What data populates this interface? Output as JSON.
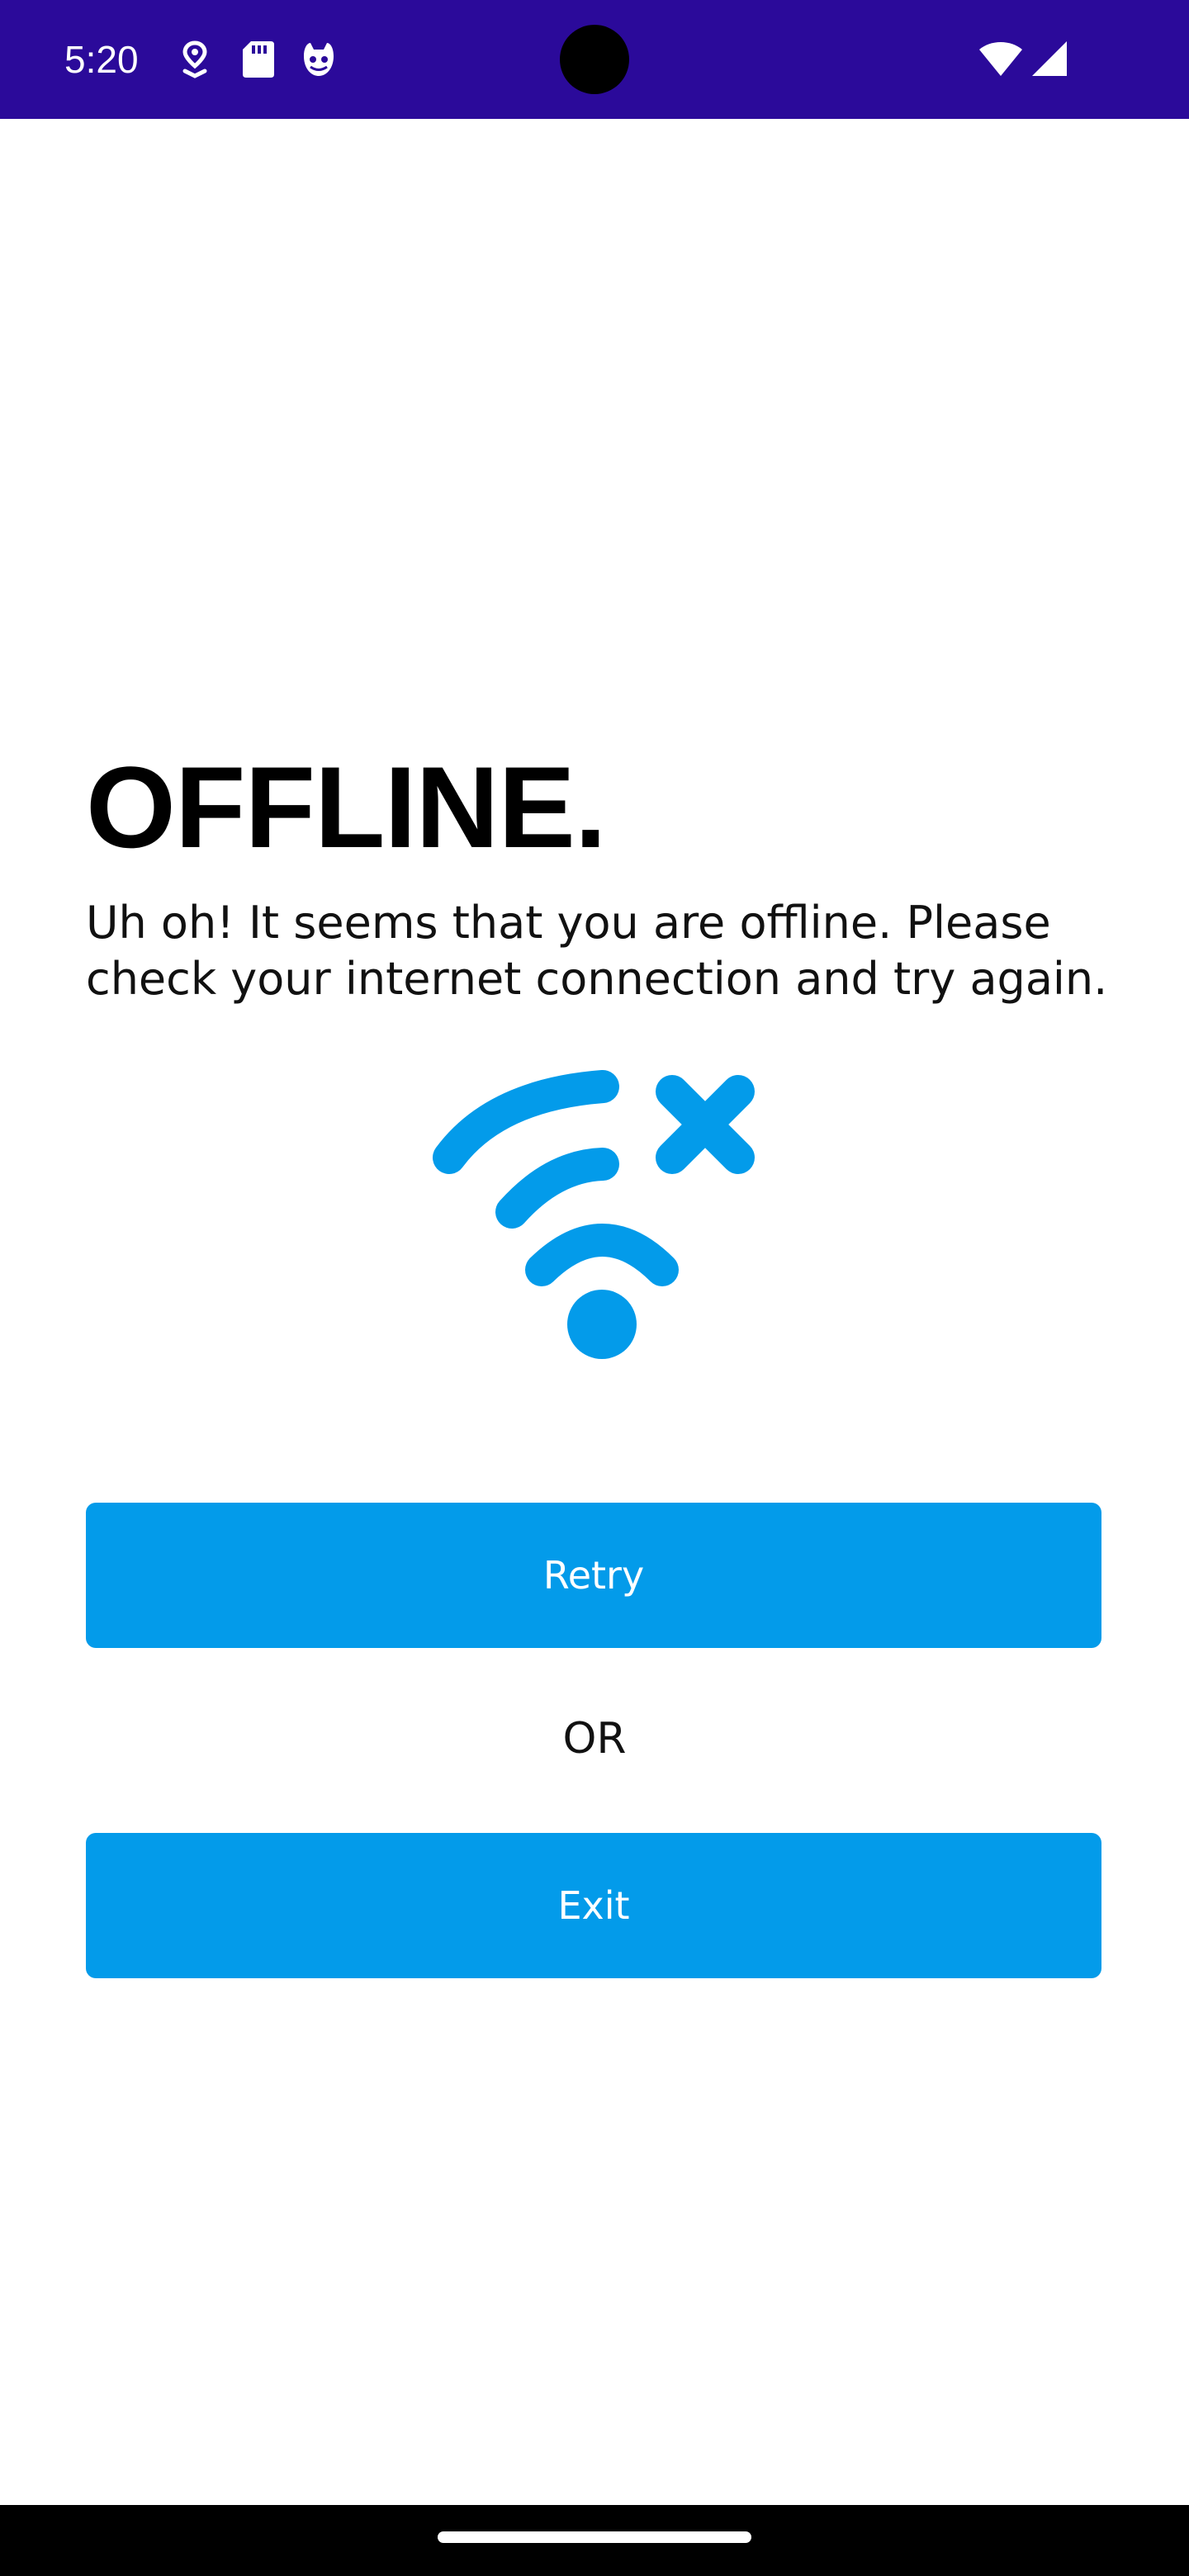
{
  "status_bar": {
    "time": "5:20",
    "background_color": "#2b0a9a",
    "left_icons": [
      "location-pin-icon",
      "sd-card-icon",
      "cat-face-icon"
    ],
    "right_icons": [
      "wifi-icon",
      "cell-signal-icon"
    ]
  },
  "content": {
    "title": "OFFLINE.",
    "message": "Uh oh! It seems that you are offline. Please check your internet connection and try again.",
    "illustration_icon": "wifi-off-icon",
    "accent_color": "#039bea"
  },
  "actions": {
    "retry_label": "Retry",
    "separator": "OR",
    "exit_label": "Exit"
  }
}
